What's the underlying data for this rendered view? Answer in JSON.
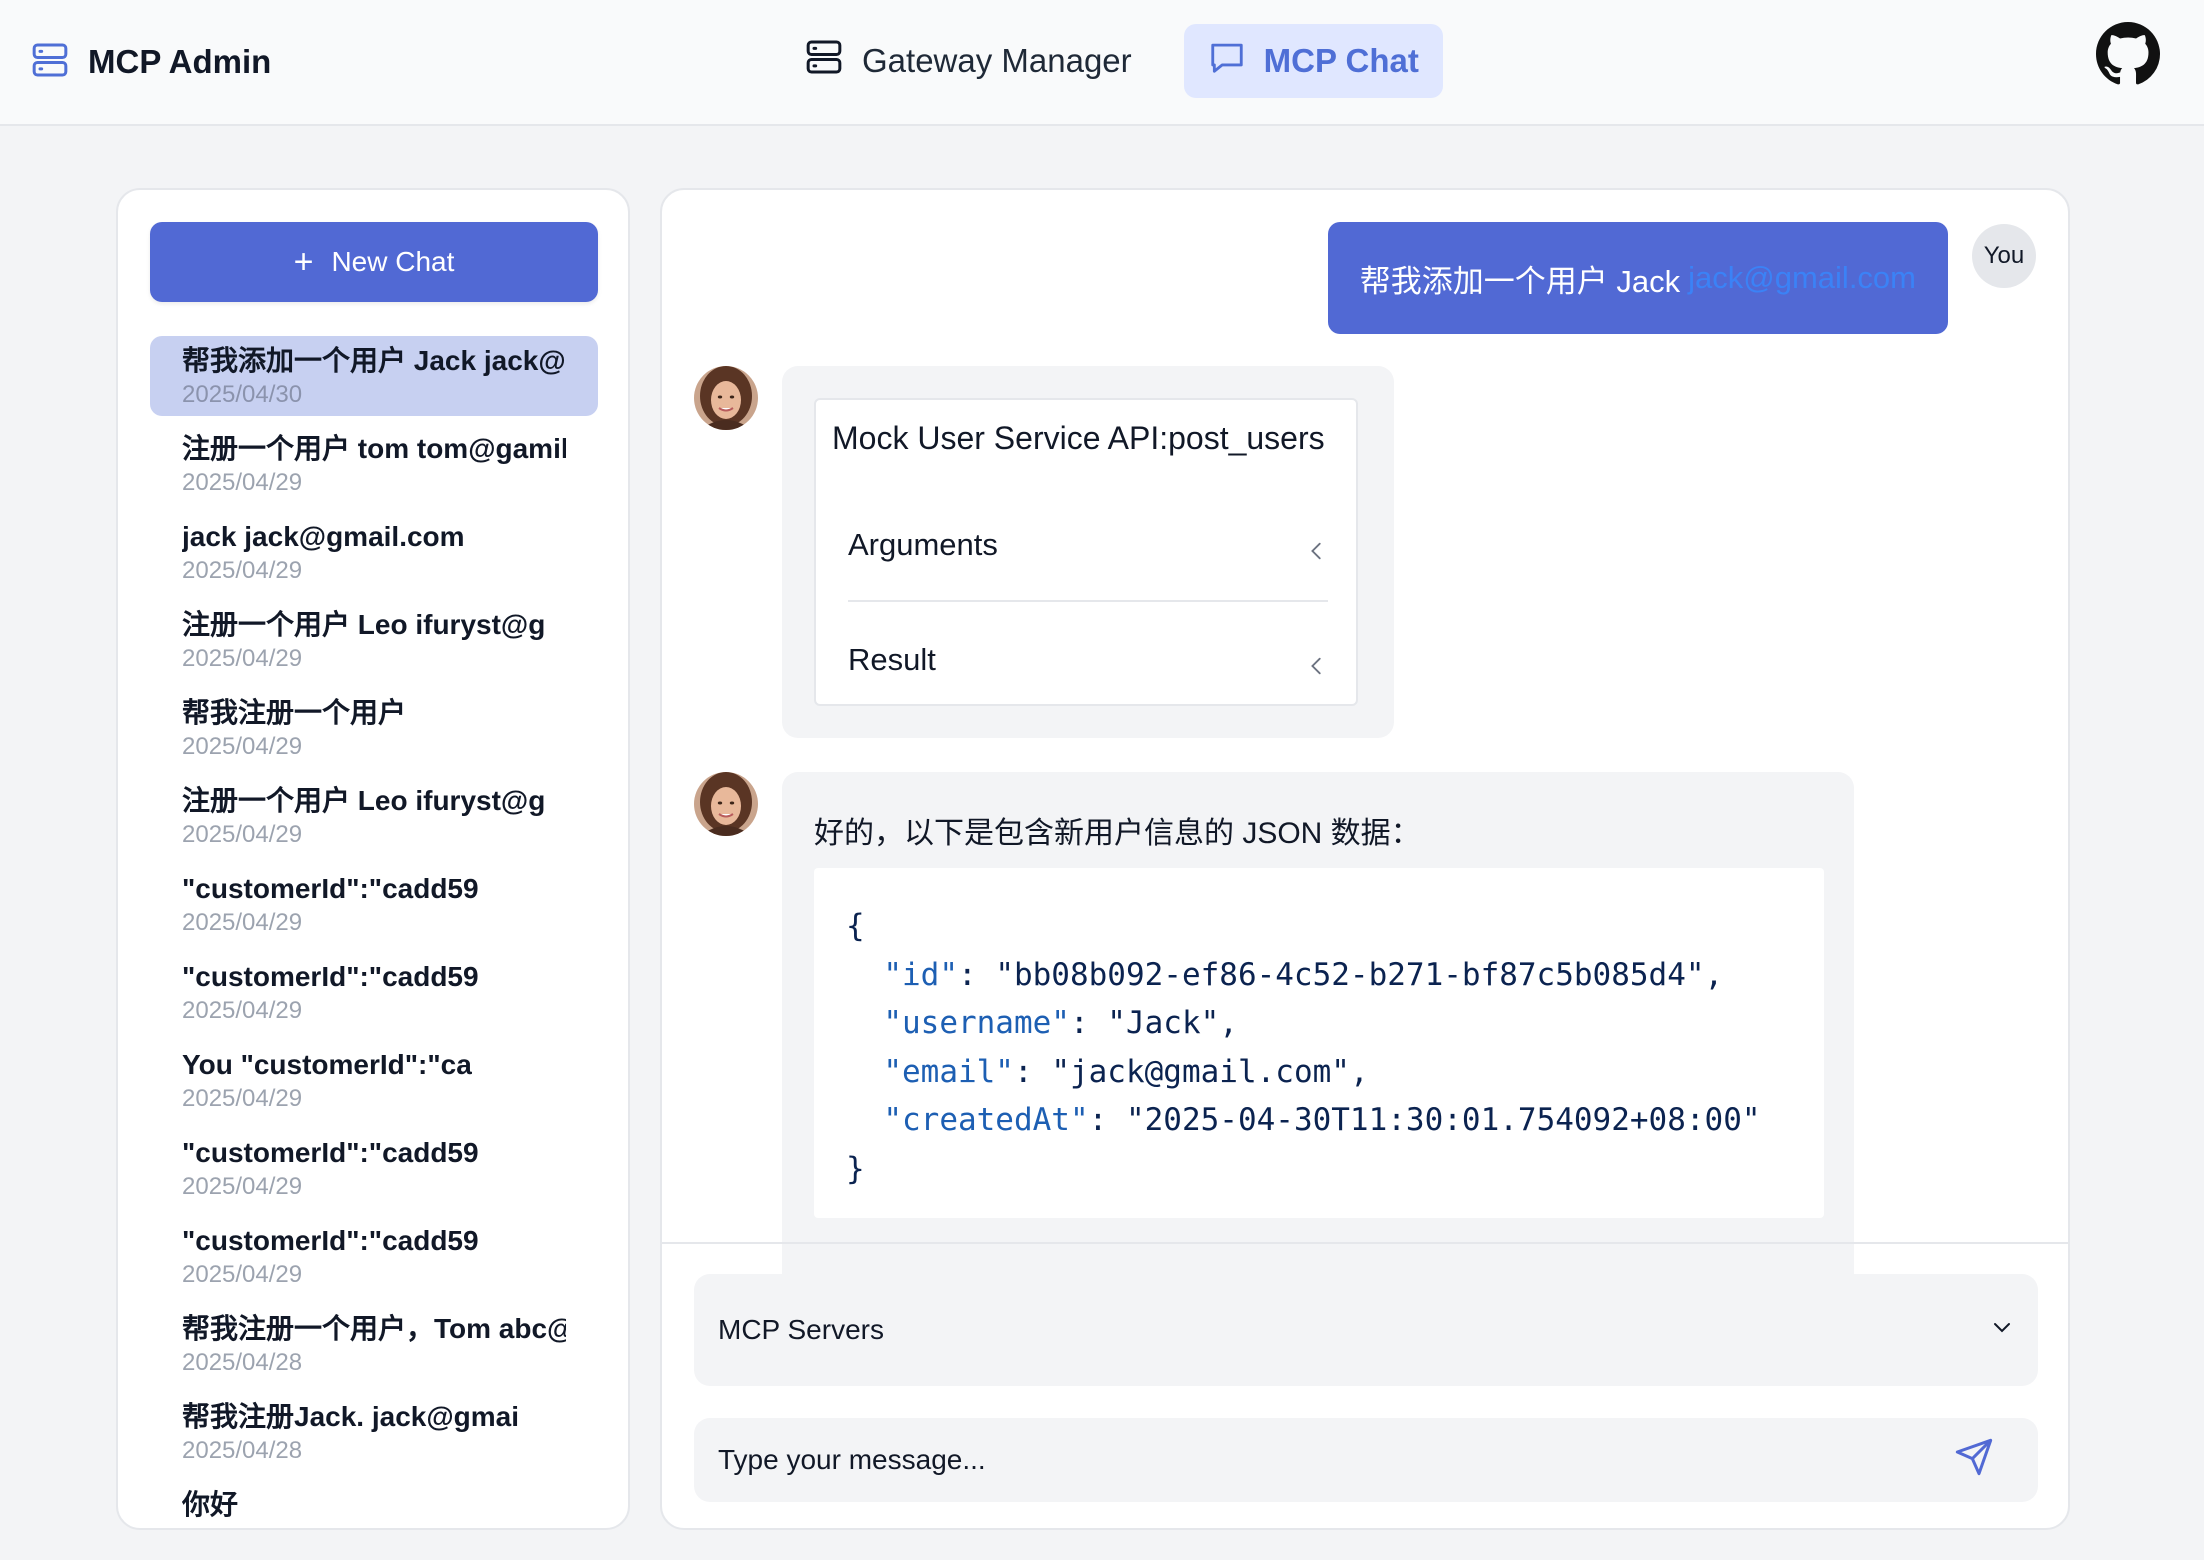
{
  "header": {
    "brand_title": "MCP Admin",
    "nav": [
      {
        "label": "Gateway Manager",
        "icon": "server-icon",
        "active": false
      },
      {
        "label": "MCP Chat",
        "icon": "chat-bubble-icon",
        "active": true
      }
    ],
    "github_icon": "github-icon"
  },
  "sidebar": {
    "new_chat_label": "New Chat",
    "conversations": [
      {
        "title": "帮我添加一个用户 Jack jack@g",
        "date": "2025/04/30",
        "active": true
      },
      {
        "title": "注册一个用户 tom tom@gamil",
        "date": "2025/04/29"
      },
      {
        "title": "jack jack@gmail.com",
        "date": "2025/04/29"
      },
      {
        "title": "注册一个用户 Leo ifuryst@g",
        "date": "2025/04/29"
      },
      {
        "title": "帮我注册一个用户",
        "date": "2025/04/29"
      },
      {
        "title": "注册一个用户 Leo ifuryst@g",
        "date": "2025/04/29"
      },
      {
        "title": "\"customerId\":\"cadd59",
        "date": "2025/04/29"
      },
      {
        "title": "\"customerId\":\"cadd59",
        "date": "2025/04/29"
      },
      {
        "title": "You \"customerId\":\"ca",
        "date": "2025/04/29"
      },
      {
        "title": "\"customerId\":\"cadd59",
        "date": "2025/04/29"
      },
      {
        "title": "\"customerId\":\"cadd59",
        "date": "2025/04/29"
      },
      {
        "title": "帮我注册一个用户，Tom abc@gm",
        "date": "2025/04/28"
      },
      {
        "title": "帮我注册Jack. jack@gmai",
        "date": "2025/04/28"
      },
      {
        "title": "你好",
        "date": ""
      }
    ]
  },
  "chat": {
    "user_message": {
      "text": "帮我添加一个用户 Jack",
      "email": "jack@gmail.com",
      "avatar_label": "You"
    },
    "tool_call": {
      "title": "Mock User Service API:post_users",
      "arguments_label": "Arguments",
      "result_label": "Result"
    },
    "assistant_reply": {
      "text": "好的，以下是包含新用户信息的 JSON 数据：",
      "code": [
        {
          "key": "\"id\"",
          "value": "\"bb08b092-ef86-4c52-b271-bf87c5b085d4\""
        },
        {
          "key": "\"username\"",
          "value": "\"Jack\""
        },
        {
          "key": "\"email\"",
          "value": "\"jack@gmail.com\""
        },
        {
          "key": "\"createdAt\"",
          "value": "\"2025-04-30T11:30:01.754092+08:00\""
        }
      ]
    }
  },
  "composer": {
    "servers_label": "MCP Servers",
    "message_placeholder": "Type your message...",
    "accent_color": "#5169d4"
  }
}
